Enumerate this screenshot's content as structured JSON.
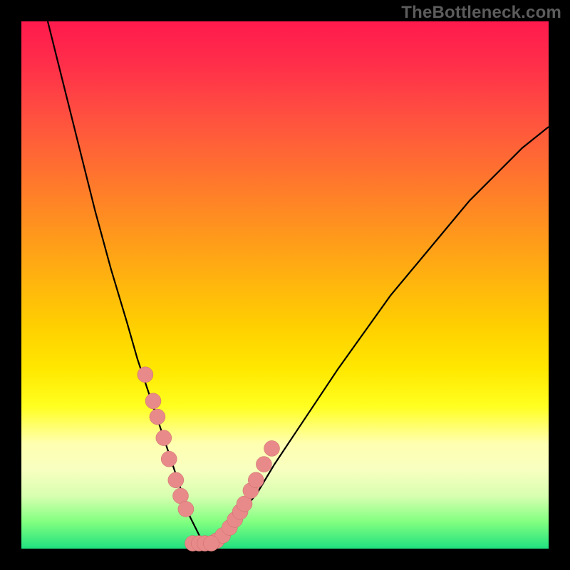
{
  "attribution": "TheBottleneck.com",
  "colors": {
    "background": "#000000",
    "curve": "#000000",
    "marker_fill": "#e98a8a",
    "marker_stroke": "#c96a6a"
  },
  "chart_data": {
    "type": "line",
    "title": "",
    "xlabel": "",
    "ylabel": "",
    "xlim": [
      0,
      100
    ],
    "ylim": [
      0,
      100
    ],
    "curve": {
      "x": [
        5,
        8,
        11,
        14,
        17,
        20,
        22,
        24,
        26,
        28,
        29,
        30,
        31,
        32,
        33,
        34,
        35,
        36,
        38,
        40,
        42,
        45,
        48,
        52,
        56,
        60,
        65,
        70,
        75,
        80,
        85,
        90,
        95,
        100
      ],
      "y": [
        100,
        88,
        76,
        64,
        53,
        43,
        36,
        30,
        24,
        18,
        15,
        12,
        9,
        6,
        4,
        2,
        1,
        1,
        2,
        4,
        7,
        11,
        16,
        22,
        28,
        34,
        41,
        48,
        54,
        60,
        66,
        71,
        76,
        80
      ]
    },
    "markers_left": {
      "x": [
        23.5,
        25.0,
        25.8,
        27.0,
        28.0,
        29.3,
        30.2,
        31.2
      ],
      "y": [
        33.0,
        28.0,
        25.0,
        21.0,
        17.0,
        13.0,
        10.0,
        7.5
      ]
    },
    "markers_right": {
      "x": [
        37.0,
        38.2,
        39.5,
        40.5,
        41.5,
        42.3,
        43.5,
        44.5,
        46.0,
        47.5
      ],
      "y": [
        1.5,
        2.5,
        4.0,
        5.5,
        7.0,
        8.5,
        11.0,
        13.0,
        16.0,
        19.0
      ]
    },
    "markers_bottom": {
      "x": [
        32.5,
        33.7,
        34.8,
        36.0
      ],
      "y": [
        1.0,
        1.0,
        1.0,
        1.0
      ]
    }
  }
}
